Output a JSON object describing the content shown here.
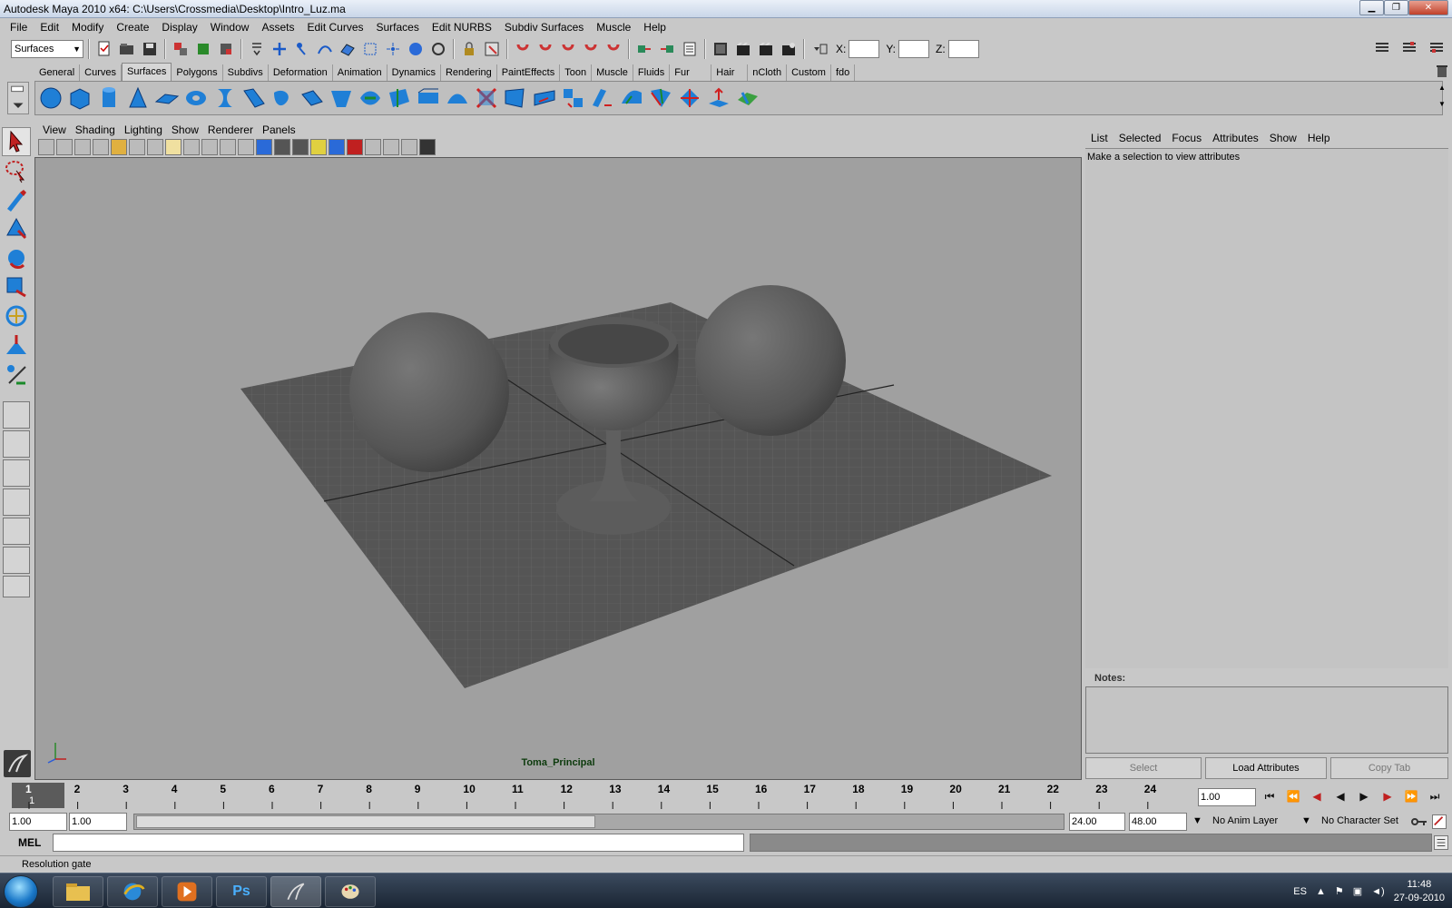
{
  "window": {
    "title": "Autodesk Maya 2010 x64: C:\\Users\\Crossmedia\\Desktop\\Intro_Luz.ma"
  },
  "menu": [
    "File",
    "Edit",
    "Modify",
    "Create",
    "Display",
    "Window",
    "Assets",
    "Edit Curves",
    "Surfaces",
    "Edit NURBS",
    "Subdiv Surfaces",
    "Muscle",
    "Help"
  ],
  "statusline": {
    "menuset": "Surfaces",
    "x_label": "X:",
    "y_label": "Y:",
    "z_label": "Z:"
  },
  "shelf_tabs": [
    "General",
    "Curves",
    "Surfaces",
    "Polygons",
    "Subdivs",
    "Deformation",
    "Animation",
    "Dynamics",
    "Rendering",
    "PaintEffects",
    "Toon",
    "Muscle",
    "Fluids",
    "Fur",
    "Hair",
    "nCloth",
    "Custom",
    "fdo"
  ],
  "shelf_active": "Surfaces",
  "viewport": {
    "menu": [
      "View",
      "Shading",
      "Lighting",
      "Show",
      "Renderer",
      "Panels"
    ],
    "camera": "Toma_Principal"
  },
  "attribute_editor": {
    "menu": [
      "List",
      "Selected",
      "Focus",
      "Attributes",
      "Show",
      "Help"
    ],
    "message": "Make a selection to view attributes",
    "notes_label": "Notes:",
    "buttons": {
      "select": "Select",
      "load": "Load Attributes",
      "copy": "Copy Tab"
    }
  },
  "time": {
    "ticks": [
      "1",
      "2",
      "3",
      "4",
      "5",
      "6",
      "7",
      "8",
      "9",
      "10",
      "11",
      "12",
      "13",
      "14",
      "15",
      "16",
      "17",
      "18",
      "19",
      "20",
      "21",
      "22",
      "23",
      "24"
    ],
    "current_frame_display": "1",
    "current_frame": "1.00",
    "range_start": "1.00",
    "range_start_inner": "1.00",
    "range_end_inner": "24.00",
    "range_end": "48.00",
    "anim_layer": "No Anim Layer",
    "character_set": "No Character Set"
  },
  "command": {
    "label": "MEL"
  },
  "helpline": "Resolution gate",
  "taskbar": {
    "language": "ES",
    "time": "11:48",
    "date": "27-09-2010"
  },
  "colors": {
    "maya_bg": "#c8c8c8",
    "viewport_bg": "#a0a0a0",
    "camera_label": "#0c3a0c",
    "shelf_icon": "#1f7fd6"
  }
}
